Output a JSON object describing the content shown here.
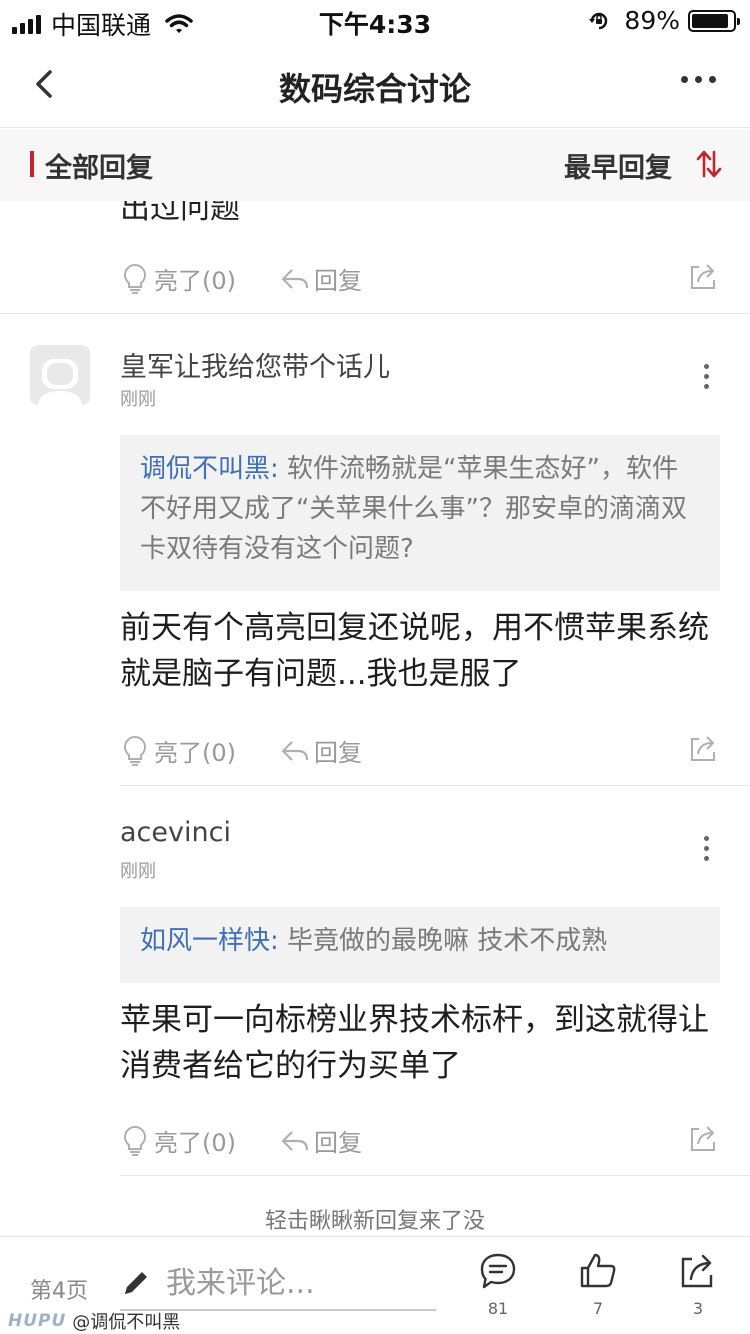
{
  "status_bar": {
    "carrier": "中国联通",
    "time": "下午4:33",
    "battery_percent": "89%",
    "battery_level": 0.89
  },
  "nav": {
    "title": "数码综合讨论",
    "back_icon": "chevron-left-icon",
    "more_icon": "more-horizontal-icon"
  },
  "section": {
    "left_label": "全部回复",
    "right_label": "最早回复",
    "accent_color": "#c4242c"
  },
  "previous_post": {
    "cut_text": "出过问题",
    "light_label": "亮了(0)",
    "reply_label": "回复"
  },
  "posts": [
    {
      "username": "皇军让我给您带个话儿",
      "time": "刚刚",
      "quote_author": "调侃不叫黑:",
      "quote_text": " 软件流畅就是“苹果生态好”，软件不好用又成了“关苹果什么事”？那安卓的滴滴双卡双待有没有这个问题?",
      "body": "前天有个高亮回复还说呢，用不惯苹果系统就是脑子有问题...我也是服了",
      "light_label": "亮了(0)",
      "reply_label": "回复"
    },
    {
      "username": "acevinci",
      "time": "刚刚",
      "quote_author": "如风一样快:",
      "quote_text": " 毕竟做的最晚嘛 技术不成熟",
      "body": "苹果可一向标榜业界技术标杆，到这就得让消费者给它的行为买单了",
      "light_label": "亮了(0)",
      "reply_label": "回复"
    }
  ],
  "load_more": "轻击瞅瞅新回复来了没",
  "bottom_bar": {
    "page_label": "第4页",
    "comment_placeholder": "我来评论...",
    "comments_count": "81",
    "likes_count": "7",
    "share_count": "3"
  },
  "watermark": {
    "logo": "HUPU",
    "text": "@调侃不叫黑"
  },
  "colors": {
    "accent": "#c4242c",
    "link": "#3f6fb6",
    "muted": "#999999"
  }
}
